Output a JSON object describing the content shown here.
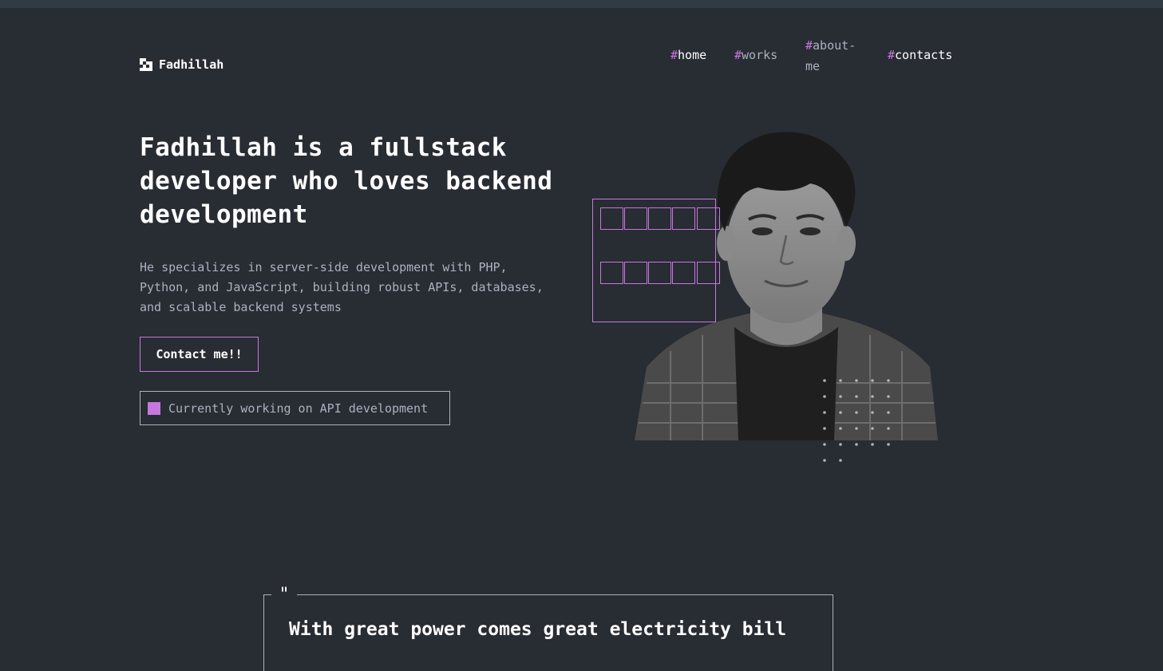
{
  "logo": {
    "text": "Fadhillah"
  },
  "nav": {
    "items": [
      {
        "hash": "#",
        "label": "home",
        "active": true
      },
      {
        "hash": "#",
        "label": "works",
        "active": false
      },
      {
        "hash": "#",
        "label": "about-me",
        "active": false
      },
      {
        "hash": "#",
        "label": "contacts",
        "active": false
      }
    ]
  },
  "hero": {
    "title": "Fadhillah is a fullstack developer who loves backend development",
    "description": "He specializes in server-side development with PHP, Python, and JavaScript, building robust APIs, databases, and scalable backend systems",
    "contact_button": "Contact me!!",
    "status_text": "Currently working on API development"
  },
  "quote": {
    "mark": "\"",
    "text": "With great power comes great electricity bill"
  },
  "colors": {
    "background": "#282c33",
    "accent": "#c778dd",
    "text": "#ffffff",
    "muted": "#abb2bf"
  },
  "icons": [
    "logo-mark-icon",
    "status-square-icon",
    "dots-pattern-icon"
  ]
}
